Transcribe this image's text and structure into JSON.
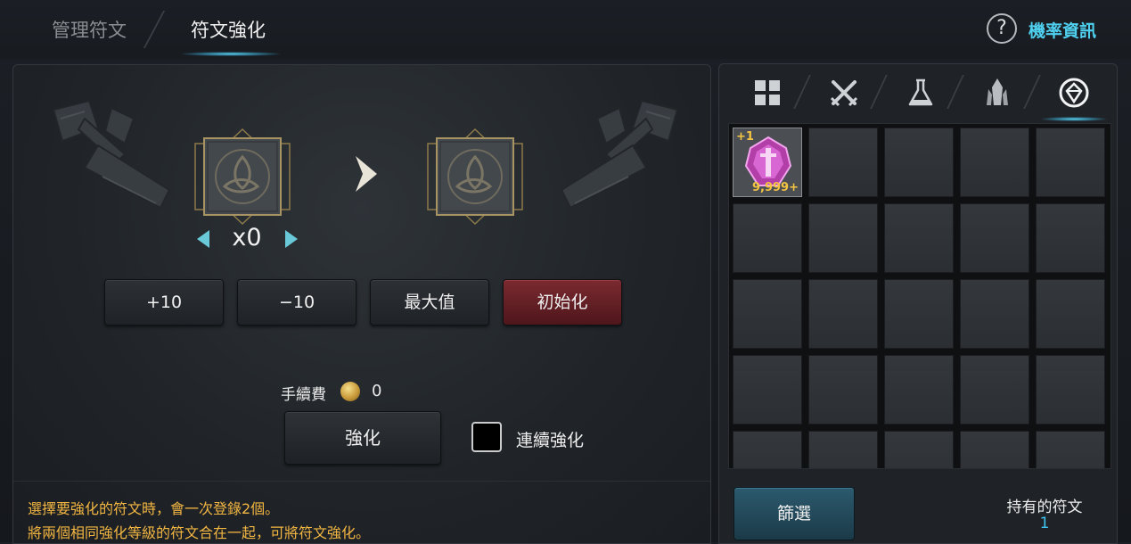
{
  "tabs": {
    "manage": "管理符文",
    "upgrade": "符文強化"
  },
  "help": {
    "label": "機率資訊",
    "icon": "question-icon",
    "glyph": "?"
  },
  "upgrade": {
    "count": "x0",
    "buttons": {
      "plus": "+10",
      "minus": "−10",
      "max": "最大值",
      "reset": "初始化"
    },
    "fee_label": "手續費",
    "fee_value": "0",
    "enhance_label": "強化",
    "continuous_label": "連續強化",
    "continuous_checked": false,
    "notes": [
      "選擇要強化的符文時，會一次登錄2個。",
      "將兩個相同強化等級的符文合在一起，可將符文強化。"
    ]
  },
  "inventory": {
    "categories": [
      "grid-icon",
      "crossed-swords-icon",
      "flask-icon",
      "crystal-icon",
      "rune-icon"
    ],
    "active_category": 4,
    "items": [
      {
        "level": "+1",
        "quantity": "9,999+",
        "icon": "pink-gem-icon"
      }
    ],
    "filter_label": "篩選",
    "owned_label": "持有的符文",
    "owned_value": "1"
  },
  "colors": {
    "accent": "#4fd0ef",
    "note_text": "#f2b642",
    "reset_button": "#7a2a30",
    "filter_button": "#2c5a6e",
    "item_badge": "#f4c542"
  }
}
